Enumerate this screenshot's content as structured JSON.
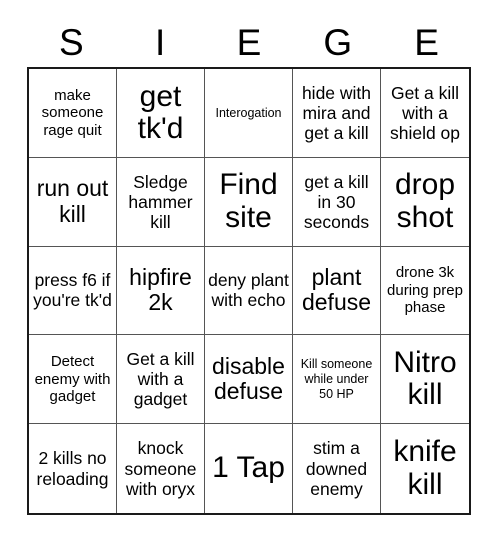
{
  "header": {
    "letters": [
      "S",
      "I",
      "E",
      "G",
      "E"
    ]
  },
  "grid": {
    "columns": 5,
    "rows": 5,
    "cells": [
      {
        "text": "make someone rage quit",
        "size": "s"
      },
      {
        "text": "get tk'd",
        "size": "xl"
      },
      {
        "text": "Interogation",
        "size": "xs"
      },
      {
        "text": "hide with mira and get a kill",
        "size": "m"
      },
      {
        "text": "Get a kill with a shield op",
        "size": "m"
      },
      {
        "text": "run out kill",
        "size": "l"
      },
      {
        "text": "Sledge hammer kill",
        "size": "m"
      },
      {
        "text": "Find site",
        "size": "xl"
      },
      {
        "text": "get a kill in 30 seconds",
        "size": "m"
      },
      {
        "text": "drop shot",
        "size": "xl"
      },
      {
        "text": "press f6 if you're tk'd",
        "size": "m"
      },
      {
        "text": "hipfire 2k",
        "size": "l"
      },
      {
        "text": "deny plant with echo",
        "size": "m"
      },
      {
        "text": "plant defuse",
        "size": "l"
      },
      {
        "text": "drone 3k during prep phase",
        "size": "s"
      },
      {
        "text": "Detect enemy with gadget",
        "size": "s"
      },
      {
        "text": "Get a kill with a gadget",
        "size": "m"
      },
      {
        "text": "disable defuse",
        "size": "l"
      },
      {
        "text": "Kill someone while under 50 HP",
        "size": "xs"
      },
      {
        "text": "Nitro kill",
        "size": "xl"
      },
      {
        "text": "2 kills no reloading",
        "size": "m"
      },
      {
        "text": "knock someone with oryx",
        "size": "m"
      },
      {
        "text": "1 Tap",
        "size": "xl"
      },
      {
        "text": "stim a downed enemy",
        "size": "m"
      },
      {
        "text": "knife kill",
        "size": "xl"
      }
    ]
  },
  "colors": {
    "background": "#ffffff",
    "text": "#000000",
    "outer_border": "#1a1a1a",
    "inner_border": "#555555"
  }
}
